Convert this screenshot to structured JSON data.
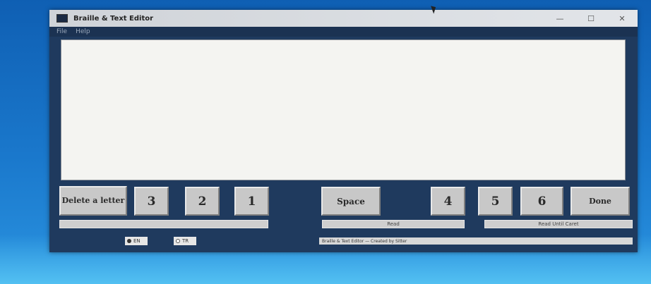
{
  "window": {
    "title": "Braille & Text Editor",
    "controls": {
      "minimize": "—",
      "maximize": "☐",
      "close": "✕"
    },
    "menu": [
      "File",
      "Help"
    ]
  },
  "editor": {
    "text": ""
  },
  "keys": {
    "delete": "Delete a letter",
    "k3": "3",
    "k2": "2",
    "k1": "1",
    "space": "Space",
    "k4": "4",
    "k5": "5",
    "k6": "6",
    "done": "Done"
  },
  "bars": {
    "left": "",
    "middle": "Read",
    "right": "Read Until Caret"
  },
  "radios": [
    {
      "label": "EN",
      "selected": true
    },
    {
      "label": "TR",
      "selected": false
    }
  ],
  "status": "Braille & Text Editor — Created by Sitter"
}
